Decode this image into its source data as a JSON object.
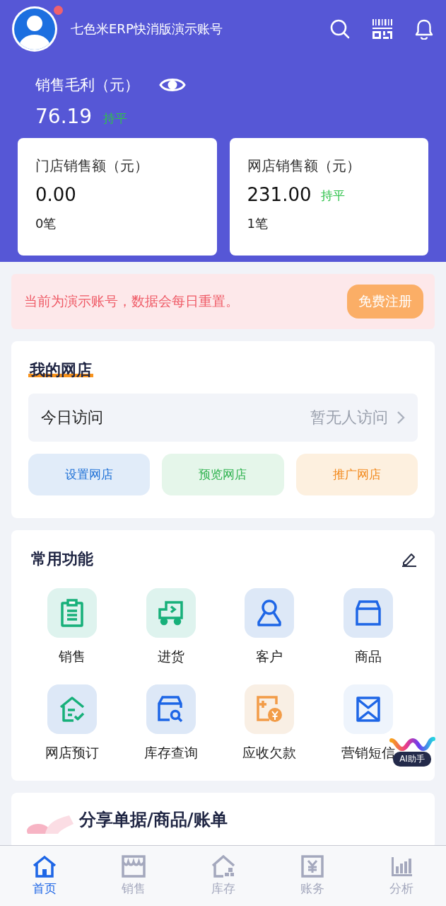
{
  "header": {
    "title": "七色米ERP快消版演示账号",
    "notification_dot": true
  },
  "profit": {
    "label": "销售毛利（元）",
    "value": "76.19",
    "trend": "持平"
  },
  "stores": [
    {
      "label": "门店销售额（元）",
      "value": "0.00",
      "count": "0笔"
    },
    {
      "label": "网店销售额（元）",
      "value": "231.00",
      "trend": "持平",
      "count": "1笔"
    }
  ],
  "notice": {
    "text": "当前为演示账号，数据会每日重置。",
    "button": "免费注册"
  },
  "my_shop": {
    "title": "我的网店",
    "visit_label": "今日访问",
    "visit_value": "暂无人访问",
    "actions": [
      {
        "label": "设置网店",
        "kind": "blue"
      },
      {
        "label": "预览网店",
        "kind": "green"
      },
      {
        "label": "推广网店",
        "kind": "orange"
      }
    ]
  },
  "functions": {
    "title": "常用功能",
    "items": [
      {
        "label": "销售",
        "kind": "clipboard"
      },
      {
        "label": "进货",
        "kind": "truck"
      },
      {
        "label": "客户",
        "kind": "person"
      },
      {
        "label": "商品",
        "kind": "box"
      },
      {
        "label": "网店预订",
        "kind": "house-check"
      },
      {
        "label": "库存查询",
        "kind": "store-search"
      },
      {
        "label": "应收欠款",
        "kind": "bill"
      },
      {
        "label": "营销短信",
        "kind": "envelope"
      }
    ]
  },
  "share_card": {
    "title": "分享单据/商品/账单"
  },
  "ai_badge": {
    "label": "AI助手"
  },
  "nav": [
    {
      "label": "首页",
      "kind": "home",
      "selected": true
    },
    {
      "label": "销售",
      "kind": "shop",
      "selected": false
    },
    {
      "label": "库存",
      "kind": "stock",
      "selected": false
    },
    {
      "label": "账务",
      "kind": "ledger",
      "selected": false
    },
    {
      "label": "分析",
      "kind": "chart",
      "selected": false
    }
  ]
}
